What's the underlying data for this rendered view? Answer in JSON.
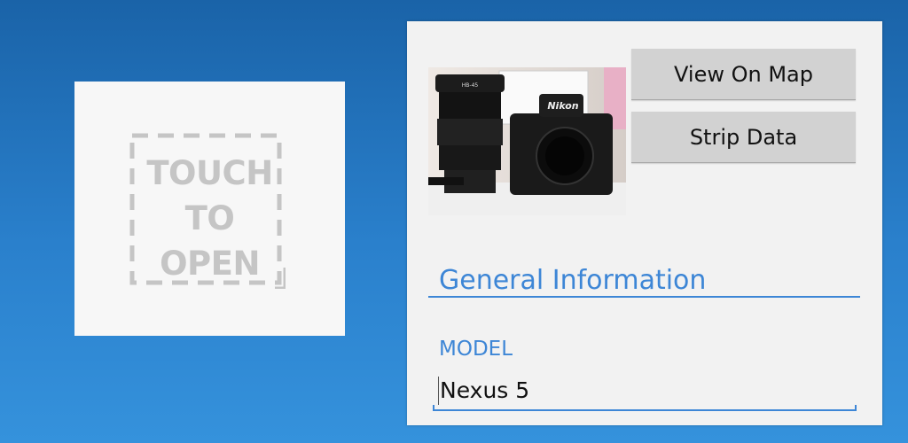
{
  "open_tile": {
    "lines": [
      "TOUCH",
      "TO",
      "OPEN"
    ],
    "icon": "dashed-frame-plus-icon"
  },
  "photo": {
    "subject": "camera-lens-photo",
    "lens_text": "HB-45",
    "brand_text": "Nikon"
  },
  "actions": {
    "view_on_map": "View On Map",
    "strip_data": "Strip Data"
  },
  "section": {
    "title": "General Information"
  },
  "fields": [
    {
      "label": "MODEL",
      "value": "Nexus 5"
    }
  ],
  "colors": {
    "accent": "#3d86d6",
    "background_top": "#1a63a8",
    "background_bottom": "#3592dc",
    "panel": "#f2f2f2",
    "button": "#d2d2d2",
    "placeholder_text": "#c5c5c5"
  }
}
